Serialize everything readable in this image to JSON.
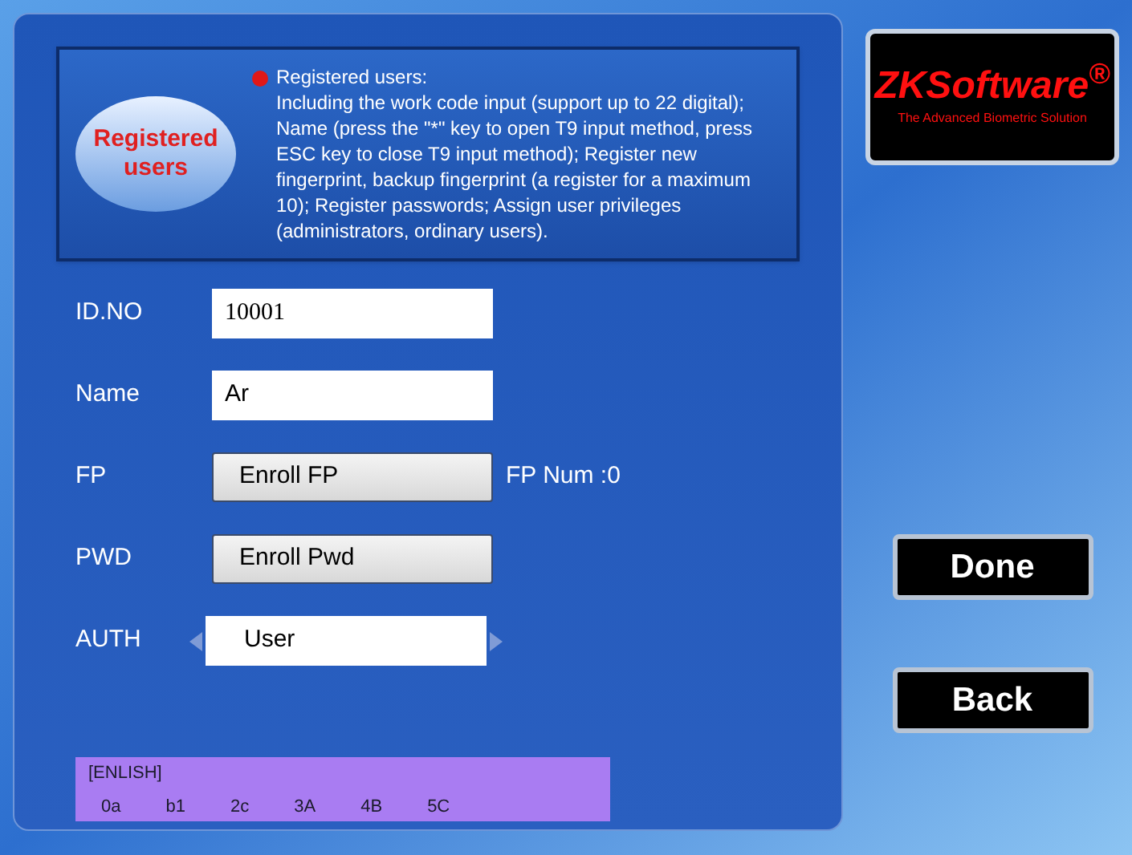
{
  "header": {
    "badge": "Registered users",
    "title": "Registered users:",
    "description": "Including the work code input (support up to 22 digital); Name (press the \"*\" key to open T9 input method, press ESC key to close T9 input method); Register new fingerprint, backup fingerprint (a register for a maximum 10); Register passwords; Assign user privileges (administrators, ordinary users)."
  },
  "form": [
    {
      "kind": "field",
      "label": "ID.NO",
      "value": "10001"
    },
    {
      "kind": "field",
      "label": "Name",
      "value": "Ar"
    },
    {
      "kind": "button",
      "label": "FP",
      "button": "Enroll FP",
      "note": "FP Num :0"
    },
    {
      "kind": "button",
      "label": "PWD",
      "button": "Enroll Pwd"
    },
    {
      "kind": "selector",
      "label": "AUTH",
      "value": "User"
    }
  ],
  "input_method": {
    "mode": "[ENLISH]",
    "candidates": [
      "0a",
      "b1",
      "2c",
      "3A",
      "4B",
      "5C"
    ]
  },
  "logo": {
    "name": "ZKSoftware$^{®}$",
    "tagline": "The Advanced Biometric Solution"
  },
  "buttons": [
    "Done",
    "Back"
  ]
}
